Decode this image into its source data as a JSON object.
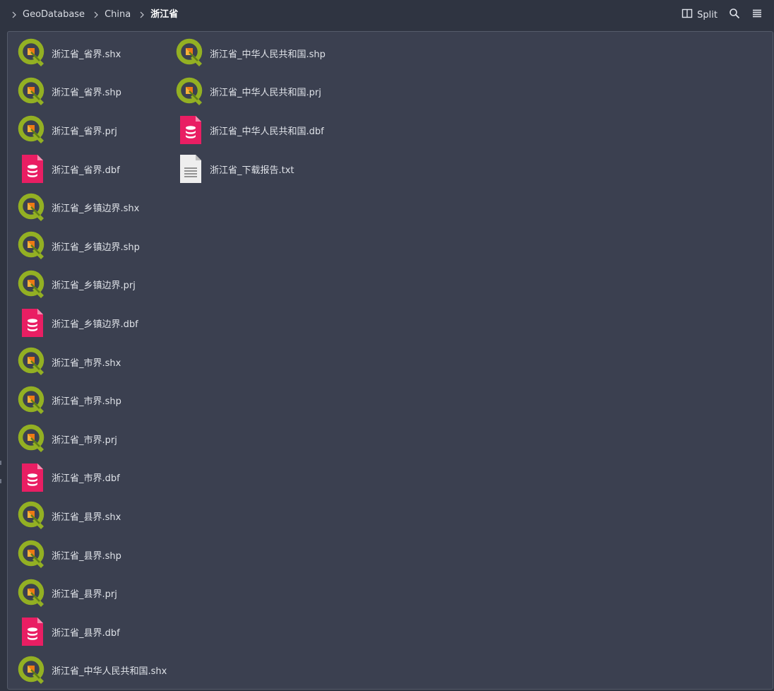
{
  "breadcrumb": {
    "items": [
      {
        "label": "GeoDatabase"
      },
      {
        "label": "China"
      },
      {
        "label": "浙江省"
      }
    ]
  },
  "toolbar": {
    "split_label": "Split",
    "split_icon": "split-view-icon",
    "search_icon": "search-icon",
    "menu_icon": "hamburger-menu-icon"
  },
  "files": [
    {
      "name": "浙江省_省界.shx",
      "type": "qgis"
    },
    {
      "name": "浙江省_省界.shp",
      "type": "qgis"
    },
    {
      "name": "浙江省_省界.prj",
      "type": "qgis"
    },
    {
      "name": "浙江省_省界.dbf",
      "type": "database"
    },
    {
      "name": "浙江省_乡镇边界.shx",
      "type": "qgis"
    },
    {
      "name": "浙江省_乡镇边界.shp",
      "type": "qgis"
    },
    {
      "name": "浙江省_乡镇边界.prj",
      "type": "qgis"
    },
    {
      "name": "浙江省_乡镇边界.dbf",
      "type": "database"
    },
    {
      "name": "浙江省_市界.shx",
      "type": "qgis"
    },
    {
      "name": "浙江省_市界.shp",
      "type": "qgis"
    },
    {
      "name": "浙江省_市界.prj",
      "type": "qgis"
    },
    {
      "name": "浙江省_市界.dbf",
      "type": "database"
    },
    {
      "name": "浙江省_县界.shx",
      "type": "qgis"
    },
    {
      "name": "浙江省_县界.shp",
      "type": "qgis"
    },
    {
      "name": "浙江省_县界.prj",
      "type": "qgis"
    },
    {
      "name": "浙江省_县界.dbf",
      "type": "database"
    },
    {
      "name": "浙江省_中华人民共和国.shx",
      "type": "qgis"
    },
    {
      "name": "浙江省_中华人民共和国.shp",
      "type": "qgis"
    },
    {
      "name": "浙江省_中华人民共和国.prj",
      "type": "qgis"
    },
    {
      "name": "浙江省_中华人民共和国.dbf",
      "type": "database"
    },
    {
      "name": "浙江省_下载报告.txt",
      "type": "text"
    }
  ],
  "colors": {
    "background": "#2f3441",
    "panel": "#3b4050",
    "qgis_green": "#93b023",
    "qgis_orange": "#ee7913",
    "database_pink": "#e91e63",
    "text_doc": "#eeeeee"
  }
}
